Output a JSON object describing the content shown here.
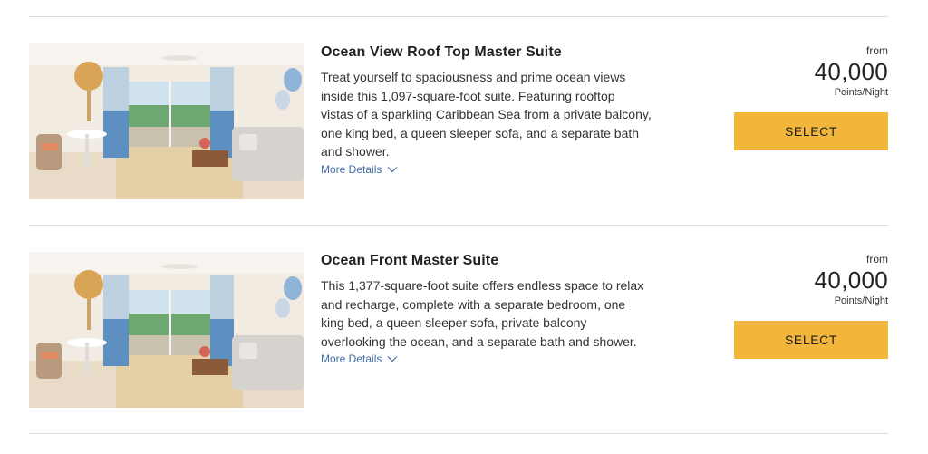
{
  "rooms": [
    {
      "title": "Ocean View Roof Top Master Suite",
      "description_lines": [
        "Treat yourself to spaciousness and prime ocean views",
        "inside this 1,097-square-foot suite. Featuring rooftop",
        "vistas of a sparkling Caribbean Sea from a private balcony,",
        "one king bed, a queen sleeper sofa, and a separate bath",
        "and shower."
      ],
      "more_details": "More Details",
      "price_prefix": "from",
      "price": "40,000",
      "price_unit": "Points/Night",
      "select_label": "SELECT"
    },
    {
      "title": "Ocean Front Master Suite",
      "description_lines": [
        "This 1,377-square-foot suite offers endless space to relax",
        "and recharge, complete with a separate bedroom, one",
        "king bed, a queen sleeper sofa, private balcony",
        "overlooking the ocean, and a separate bath and shower."
      ],
      "more_details": "More Details",
      "price_prefix": "from",
      "price": "40,000",
      "price_unit": "Points/Night",
      "select_label": "SELECT"
    }
  ],
  "colors": {
    "select_button": "#f2b63c",
    "link": "#3f6ba7",
    "divider": "#dcdcdc"
  },
  "icons": {
    "more_details": "chevron-down-icon"
  }
}
